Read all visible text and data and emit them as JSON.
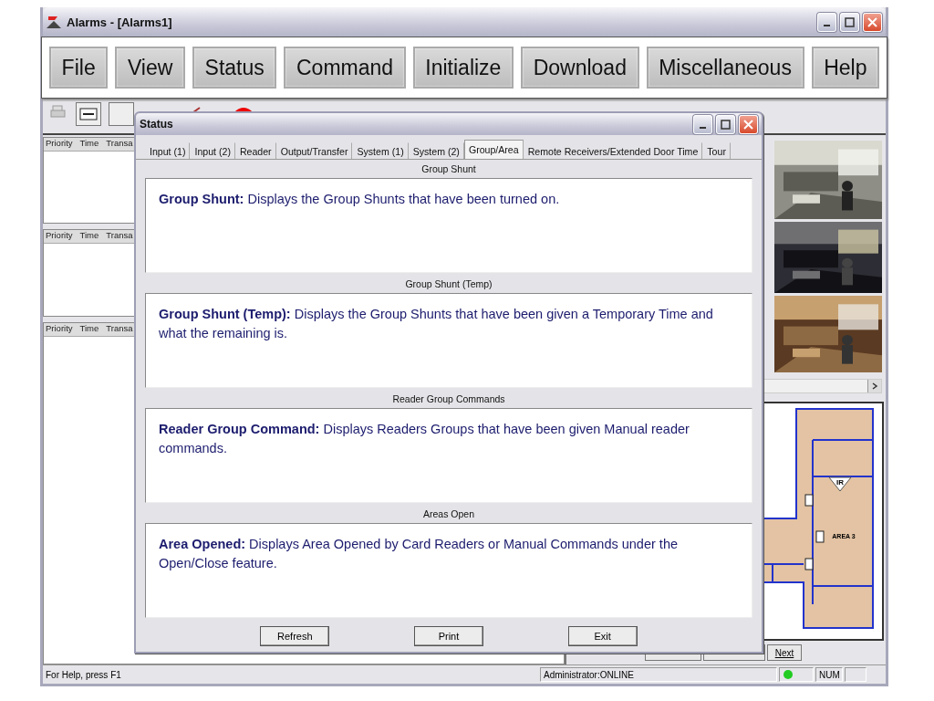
{
  "window": {
    "title": "Alarms - [Alarms1]"
  },
  "menu": [
    "File",
    "View",
    "Status",
    "Command",
    "Initialize",
    "Download",
    "Miscellaneous",
    "Help"
  ],
  "alarm_lists": [
    {
      "columns": [
        "Priority",
        "Time",
        "Transa"
      ]
    },
    {
      "columns": [
        "Priority",
        "Time",
        "Transa"
      ]
    },
    {
      "columns": [
        "Priority",
        "Time",
        "Transa"
      ]
    }
  ],
  "cameras": [
    {
      "kind": "picture"
    },
    {
      "kind": "picture"
    },
    {
      "kind": "picture"
    }
  ],
  "map": {
    "area_label": "AREA 3",
    "sensor_label": "IR"
  },
  "map_buttons": [
    {
      "label": "Next"
    }
  ],
  "status_bar": {
    "help": "For Help, press F1",
    "user": "Administrator:ONLINE",
    "num": "NUM"
  },
  "dialog": {
    "title": "Status",
    "tabs": [
      {
        "label": "Input (1)",
        "selected": false
      },
      {
        "label": "Input (2)",
        "selected": false
      },
      {
        "label": "Reader",
        "selected": false
      },
      {
        "label": "Output/Transfer",
        "selected": false
      },
      {
        "label": "System (1)",
        "selected": false
      },
      {
        "label": "System (2)",
        "selected": false
      },
      {
        "label": "Group/Area",
        "selected": true
      },
      {
        "label": "Remote Receivers/Extended Door Time",
        "selected": false
      },
      {
        "label": "Tour",
        "selected": false
      }
    ],
    "sections": [
      {
        "caption": "Group Shunt",
        "description": "**Group Shunt:** Displays the Group Shunts that have been turned on."
      },
      {
        "caption": "Group Shunt (Temp)",
        "description": "**Group Shunt (Temp):** Displays the Group Shunts that have been given a Temporary Time and what the remaining is."
      },
      {
        "caption": "Reader Group Commands",
        "description": "**Reader Group Command:** Displays Readers Groups that have been given Manual reader commands."
      },
      {
        "caption": "Areas Open",
        "description": "**Area Opened:** Displays Area Opened by Card Readers or Manual Commands under the Open/Close feature."
      }
    ],
    "buttons": [
      "Refresh",
      "Print",
      "Exit"
    ]
  }
}
